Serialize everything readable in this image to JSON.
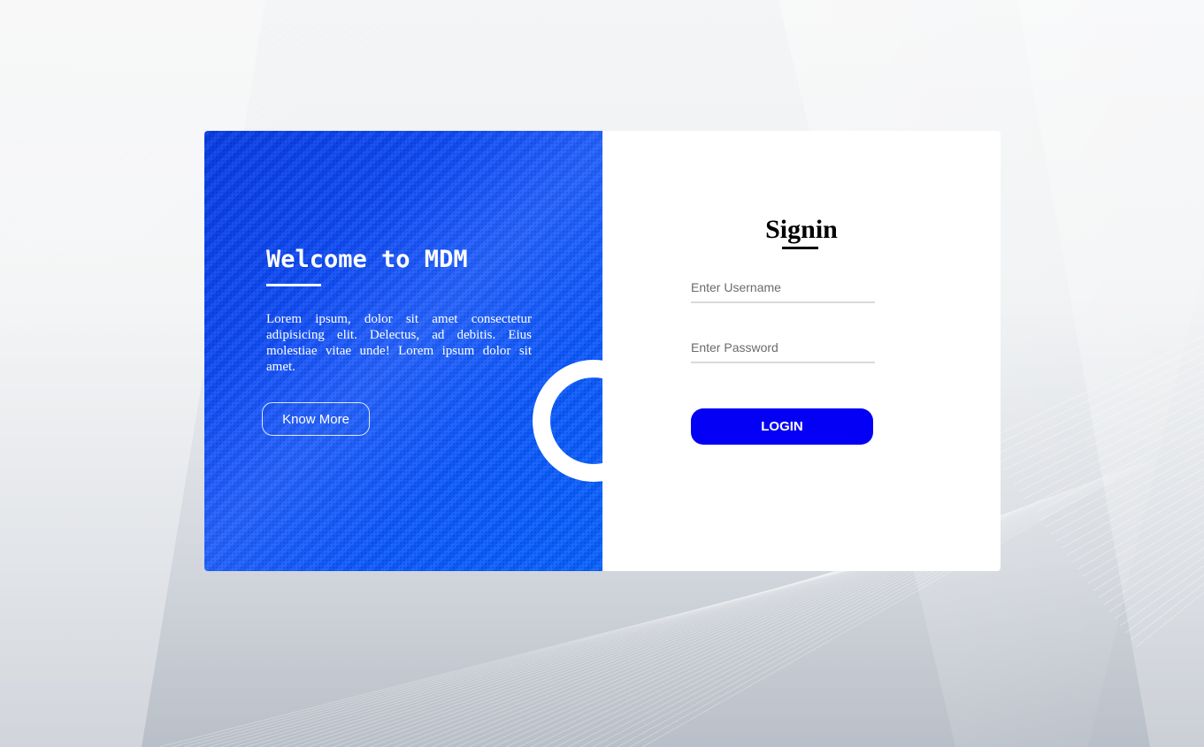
{
  "welcome": {
    "title": "Welcome to MDM",
    "description": "Lorem ipsum, dolor sit amet consectetur adipisicing elit. Delectus, ad debitis. Eius molestiae vitae unde! Lorem ipsum dolor sit amet.",
    "button_label": "Know More"
  },
  "signin": {
    "title": "Signin",
    "username_placeholder": "Enter Username",
    "username_value": "",
    "password_placeholder": "Enter Password",
    "password_value": "",
    "login_label": "LOGIN"
  },
  "colors": {
    "panel_blue": "#1456ff",
    "login_button": "#0400f5",
    "card_white": "#ffffff"
  }
}
